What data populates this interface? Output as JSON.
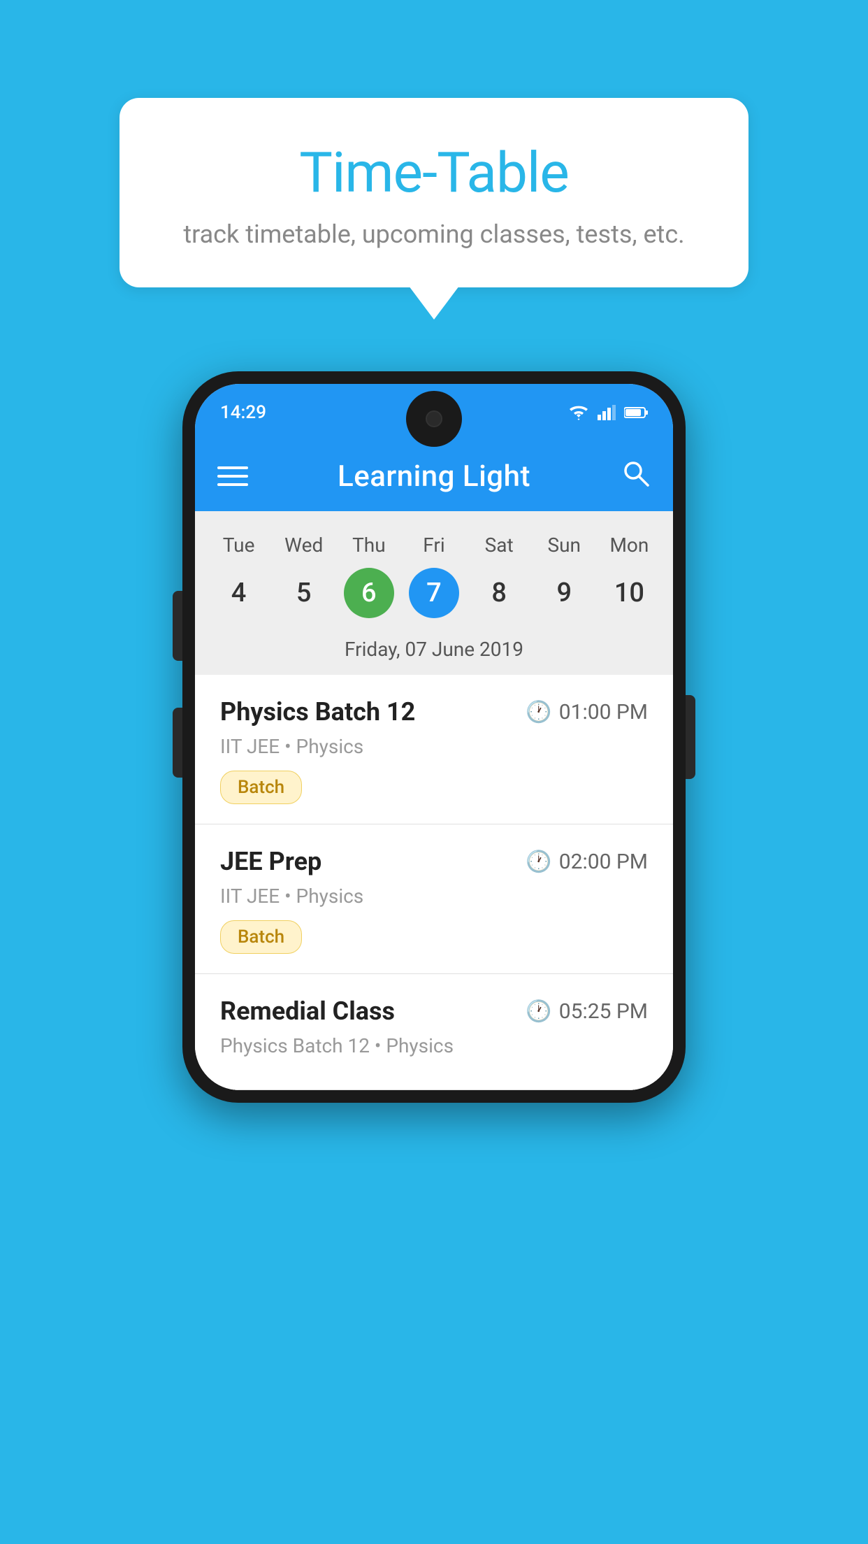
{
  "bubble": {
    "title": "Time-Table",
    "subtitle": "track timetable, upcoming classes, tests, etc."
  },
  "phone": {
    "status": {
      "time": "14:29"
    },
    "header": {
      "title": "Learning Light"
    },
    "calendar": {
      "days": [
        "Tue",
        "Wed",
        "Thu",
        "Fri",
        "Sat",
        "Sun",
        "Mon"
      ],
      "dates": [
        "4",
        "5",
        "6",
        "7",
        "8",
        "9",
        "10"
      ],
      "today_index": 2,
      "selected_index": 3,
      "selected_label": "Friday, 07 June 2019"
    },
    "schedule": [
      {
        "title": "Physics Batch 12",
        "time": "01:00 PM",
        "meta": "IIT JEE • Physics",
        "badge": "Batch"
      },
      {
        "title": "JEE Prep",
        "time": "02:00 PM",
        "meta": "IIT JEE • Physics",
        "badge": "Batch"
      },
      {
        "title": "Remedial Class",
        "time": "05:25 PM",
        "meta": "Physics Batch 12 • Physics",
        "badge": ""
      }
    ]
  }
}
